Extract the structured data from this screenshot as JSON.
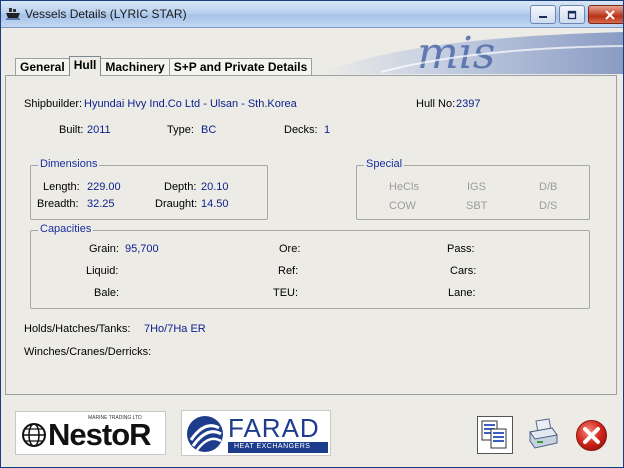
{
  "window": {
    "title": "Vessels Details  (LYRIC STAR)"
  },
  "tabs": [
    {
      "label": "General"
    },
    {
      "label": "Hull"
    },
    {
      "label": "Machinery"
    },
    {
      "label": "S+P and Private Details"
    }
  ],
  "hull": {
    "shipbuilder_label": "Shipbuilder:",
    "shipbuilder": "Hyundai Hvy Ind.Co Ltd - Ulsan - Sth.Korea",
    "hull_no_label": "Hull No:",
    "hull_no": "2397",
    "built_label": "Built:",
    "built": "2011",
    "type_label": "Type:",
    "type": "BC",
    "decks_label": "Decks:",
    "decks": "1"
  },
  "dimensions": {
    "title": "Dimensions",
    "length_label": "Length:",
    "length": "229.00",
    "depth_label": "Depth:",
    "depth": "20.10",
    "breadth_label": "Breadth:",
    "breadth": "32.25",
    "draught_label": "Draught:",
    "draught": "14.50"
  },
  "special": {
    "title": "Special",
    "items": [
      "HeCls",
      "IGS",
      "D/B",
      "COW",
      "SBT",
      "D/S"
    ]
  },
  "capacities": {
    "title": "Capacities",
    "grain_label": "Grain:",
    "grain": "95,700",
    "liquid_label": "Liquid:",
    "bale_label": "Bale:",
    "ore_label": "Ore:",
    "ref_label": "Ref:",
    "teu_label": "TEU:",
    "pass_label": "Pass:",
    "cars_label": "Cars:",
    "lane_label": "Lane:"
  },
  "holds": {
    "label": "Holds/Hatches/Tanks:",
    "value": "7Ho/7Ha ER"
  },
  "winches": {
    "label": "Winches/Cranes/Derricks:"
  },
  "logos": {
    "nestor_small": "MARINE TRADING LTD",
    "nestor": "NestoR",
    "farad": "FARAD",
    "farad_sub": "HEAT EXCHANGERS"
  },
  "icons": {
    "copy": "copy-documents-icon",
    "print": "printer-icon",
    "close": "close-red-icon"
  }
}
